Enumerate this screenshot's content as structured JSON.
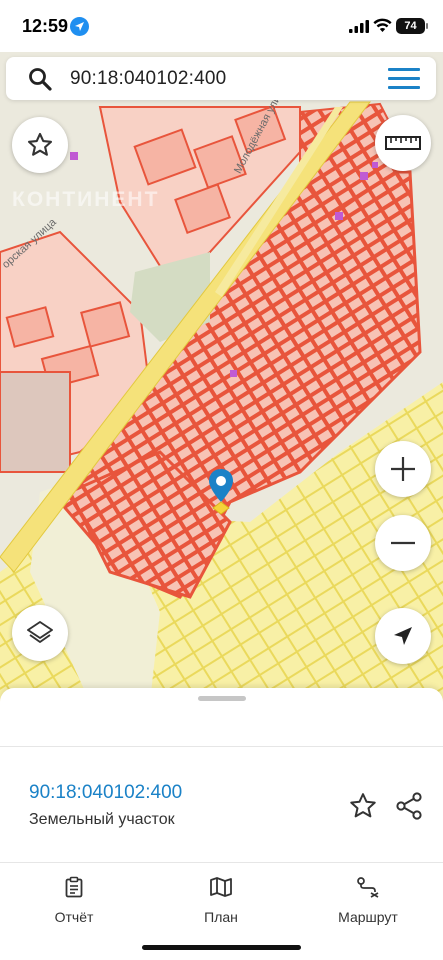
{
  "status_bar": {
    "time": "12:59",
    "battery": "74"
  },
  "search": {
    "value": "90:18:040102:400",
    "search_icon": "search-icon",
    "menu_icon": "hamburger-menu-icon"
  },
  "map": {
    "watermark": "КОНТИНЕНТ",
    "street_labels": [
      "Молодёжная улица",
      "орская улица"
    ],
    "buttons": {
      "favorite": "star-icon",
      "ruler": "ruler-icon",
      "zoom_in": "plus-icon",
      "zoom_out": "minus-icon",
      "layers": "layers-icon",
      "locate": "navigation-arrow-icon"
    },
    "marker_icon": "location-pin-icon",
    "colors": {
      "background": "#ebe9dd",
      "parcel_stroke": "#e8553c",
      "parcel_fill": "#f6b4a4",
      "yellow_zone": "#f7ef9f",
      "road": "#f5e27a",
      "pin": "#1b82c7"
    }
  },
  "sheet": {
    "parcel_id": "90:18:040102:400",
    "parcel_type": "Земельный участок",
    "actions": [
      "star-icon",
      "share-icon"
    ]
  },
  "nav": {
    "report": "Отчёт",
    "plan": "План",
    "route": "Маршрут"
  },
  "accent": "#1b82c7"
}
